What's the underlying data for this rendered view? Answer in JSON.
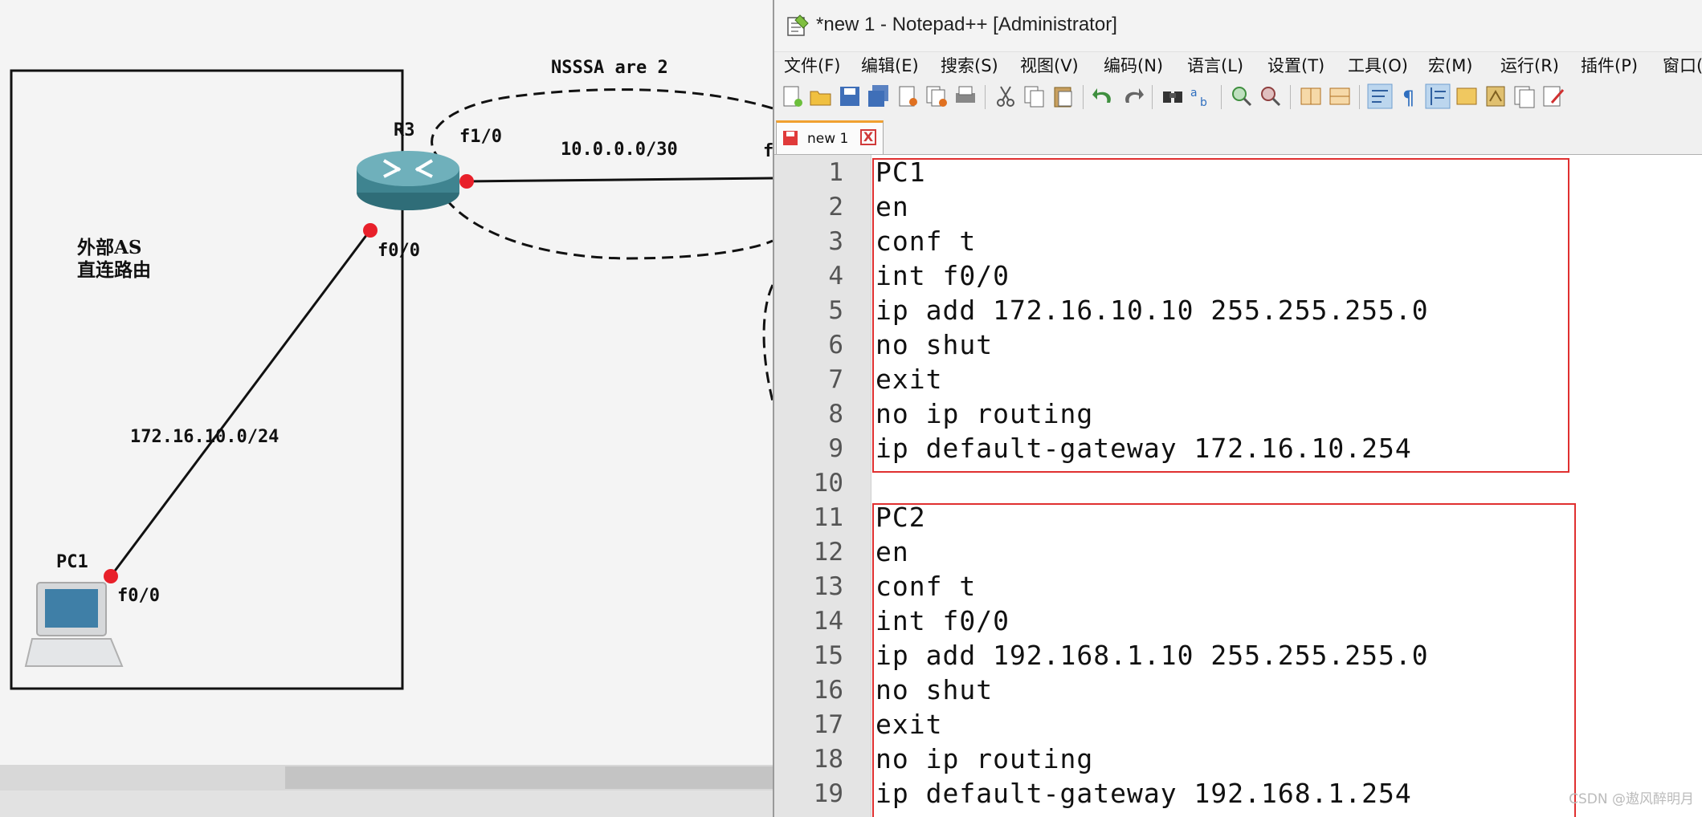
{
  "topology": {
    "area_label": "NSSSA  are 2",
    "router_name": "R3",
    "router_port_top": "f1/0",
    "router_port_bottom": "f0/0",
    "link_top_subnet": "10.0.0.0/30",
    "link_top_far_port": "f",
    "external_as_label": "外部AS",
    "direct_route_label": "直连路由",
    "link_bottom_subnet": "172.16.10.0/24",
    "pc_name": "PC1",
    "pc_port": "f0/0"
  },
  "window": {
    "title": "*new 1 - Notepad++ [Administrator]"
  },
  "menu": [
    "文件(F)",
    "编辑(E)",
    "搜索(S)",
    "视图(V)",
    "编码(N)",
    "语言(L)",
    "设置(T)",
    "工具(O)",
    "宏(M)",
    "运行(R)",
    "插件(P)",
    "窗口("
  ],
  "tab": {
    "label": "new 1",
    "close": "X"
  },
  "editor": {
    "lines": [
      {
        "num": "1",
        "text": "PC1"
      },
      {
        "num": "2",
        "text": "en"
      },
      {
        "num": "3",
        "text": "conf t"
      },
      {
        "num": "4",
        "text": "int f0/0"
      },
      {
        "num": "5",
        "text": "ip add 172.16.10.10 255.255.255.0"
      },
      {
        "num": "6",
        "text": "no shut"
      },
      {
        "num": "7",
        "text": "exit"
      },
      {
        "num": "8",
        "text": "no ip routing"
      },
      {
        "num": "9",
        "text": "ip default-gateway 172.16.10.254"
      },
      {
        "num": "10",
        "text": ""
      },
      {
        "num": "11",
        "text": "PC2"
      },
      {
        "num": "12",
        "text": "en"
      },
      {
        "num": "13",
        "text": "conf t"
      },
      {
        "num": "14",
        "text": "int f0/0"
      },
      {
        "num": "15",
        "text": "ip add 192.168.1.10 255.255.255.0"
      },
      {
        "num": "16",
        "text": "no shut"
      },
      {
        "num": "17",
        "text": "exit"
      },
      {
        "num": "18",
        "text": "no ip routing"
      },
      {
        "num": "19",
        "text": "ip default-gateway 192.168.1.254"
      }
    ]
  },
  "watermark": "CSDN @遨风醉明月",
  "colors": {
    "highlight_box": "#e03030",
    "interface_dot": "#e8202a",
    "router_body": "#4a8a96"
  }
}
